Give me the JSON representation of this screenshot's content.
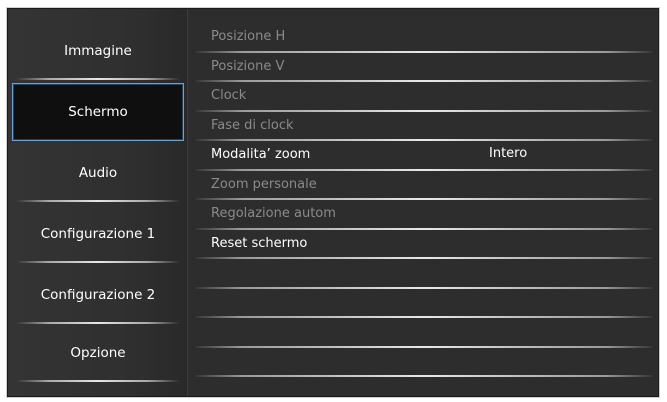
{
  "sidebar": {
    "items": [
      {
        "label": "Immagine"
      },
      {
        "label": "Schermo"
      },
      {
        "label": "Audio"
      },
      {
        "label": "Configurazione 1"
      },
      {
        "label": "Configurazione 2"
      },
      {
        "label": "Opzione"
      }
    ],
    "selected": "Schermo"
  },
  "menu": {
    "rows": [
      {
        "label": "Posizione H",
        "enabled": false
      },
      {
        "label": "Posizione V",
        "enabled": false
      },
      {
        "label": "Clock",
        "enabled": false
      },
      {
        "label": "Fase di clock",
        "enabled": false
      },
      {
        "label": "Modalita’ zoom",
        "value": "Intero",
        "enabled": true
      },
      {
        "label": "Zoom personale",
        "enabled": false
      },
      {
        "label": "Regolazione autom",
        "enabled": false
      },
      {
        "label": "Reset schermo",
        "enabled": true
      },
      {
        "label": "",
        "enabled": false
      },
      {
        "label": "",
        "enabled": false
      },
      {
        "label": "",
        "enabled": false
      },
      {
        "label": "",
        "enabled": false
      }
    ]
  },
  "colors": {
    "background": "#2d2d2d",
    "selected_background": "#0f0f0f",
    "selected_border": "#6aa2d8",
    "text_enabled": "#ffffff",
    "text_disabled": "#8a8a8a"
  }
}
